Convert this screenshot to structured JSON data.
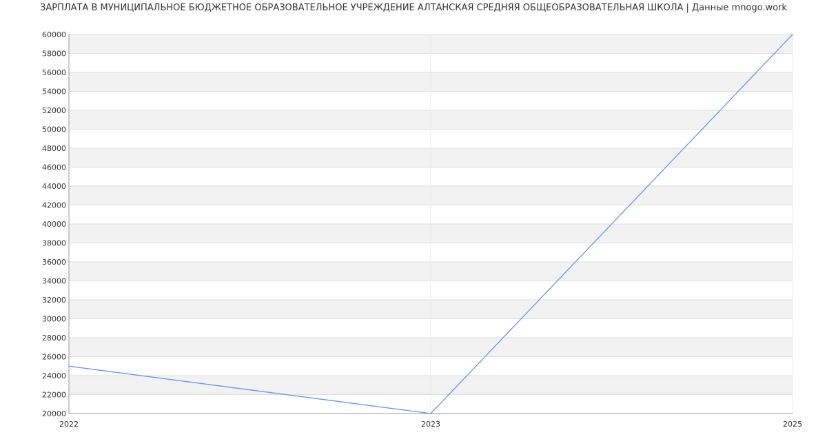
{
  "chart_data": {
    "type": "line",
    "title": "ЗАРПЛАТА В МУНИЦИПАЛЬНОЕ БЮДЖЕТНОЕ ОБРАЗОВАТЕЛЬНОЕ УЧРЕЖДЕНИЕ АЛТАНСКАЯ СРЕДНЯЯ ОБЩЕОБРАЗОВАТЕЛЬНАЯ ШКОЛА | Данные mnogo.work",
    "x": [
      "2022",
      "2023",
      "2025"
    ],
    "series": [
      {
        "values": [
          25000,
          20000,
          60000
        ]
      }
    ],
    "ylim": [
      20000,
      60000
    ],
    "yticks": [
      20000,
      22000,
      24000,
      26000,
      28000,
      30000,
      32000,
      34000,
      36000,
      38000,
      40000,
      42000,
      44000,
      46000,
      48000,
      50000,
      52000,
      54000,
      56000,
      58000,
      60000
    ],
    "grid": true,
    "colors": {
      "line": "#6495ED",
      "band": "#F2F2F2",
      "grid": "#DDDDDD",
      "axis": "#999999"
    }
  }
}
